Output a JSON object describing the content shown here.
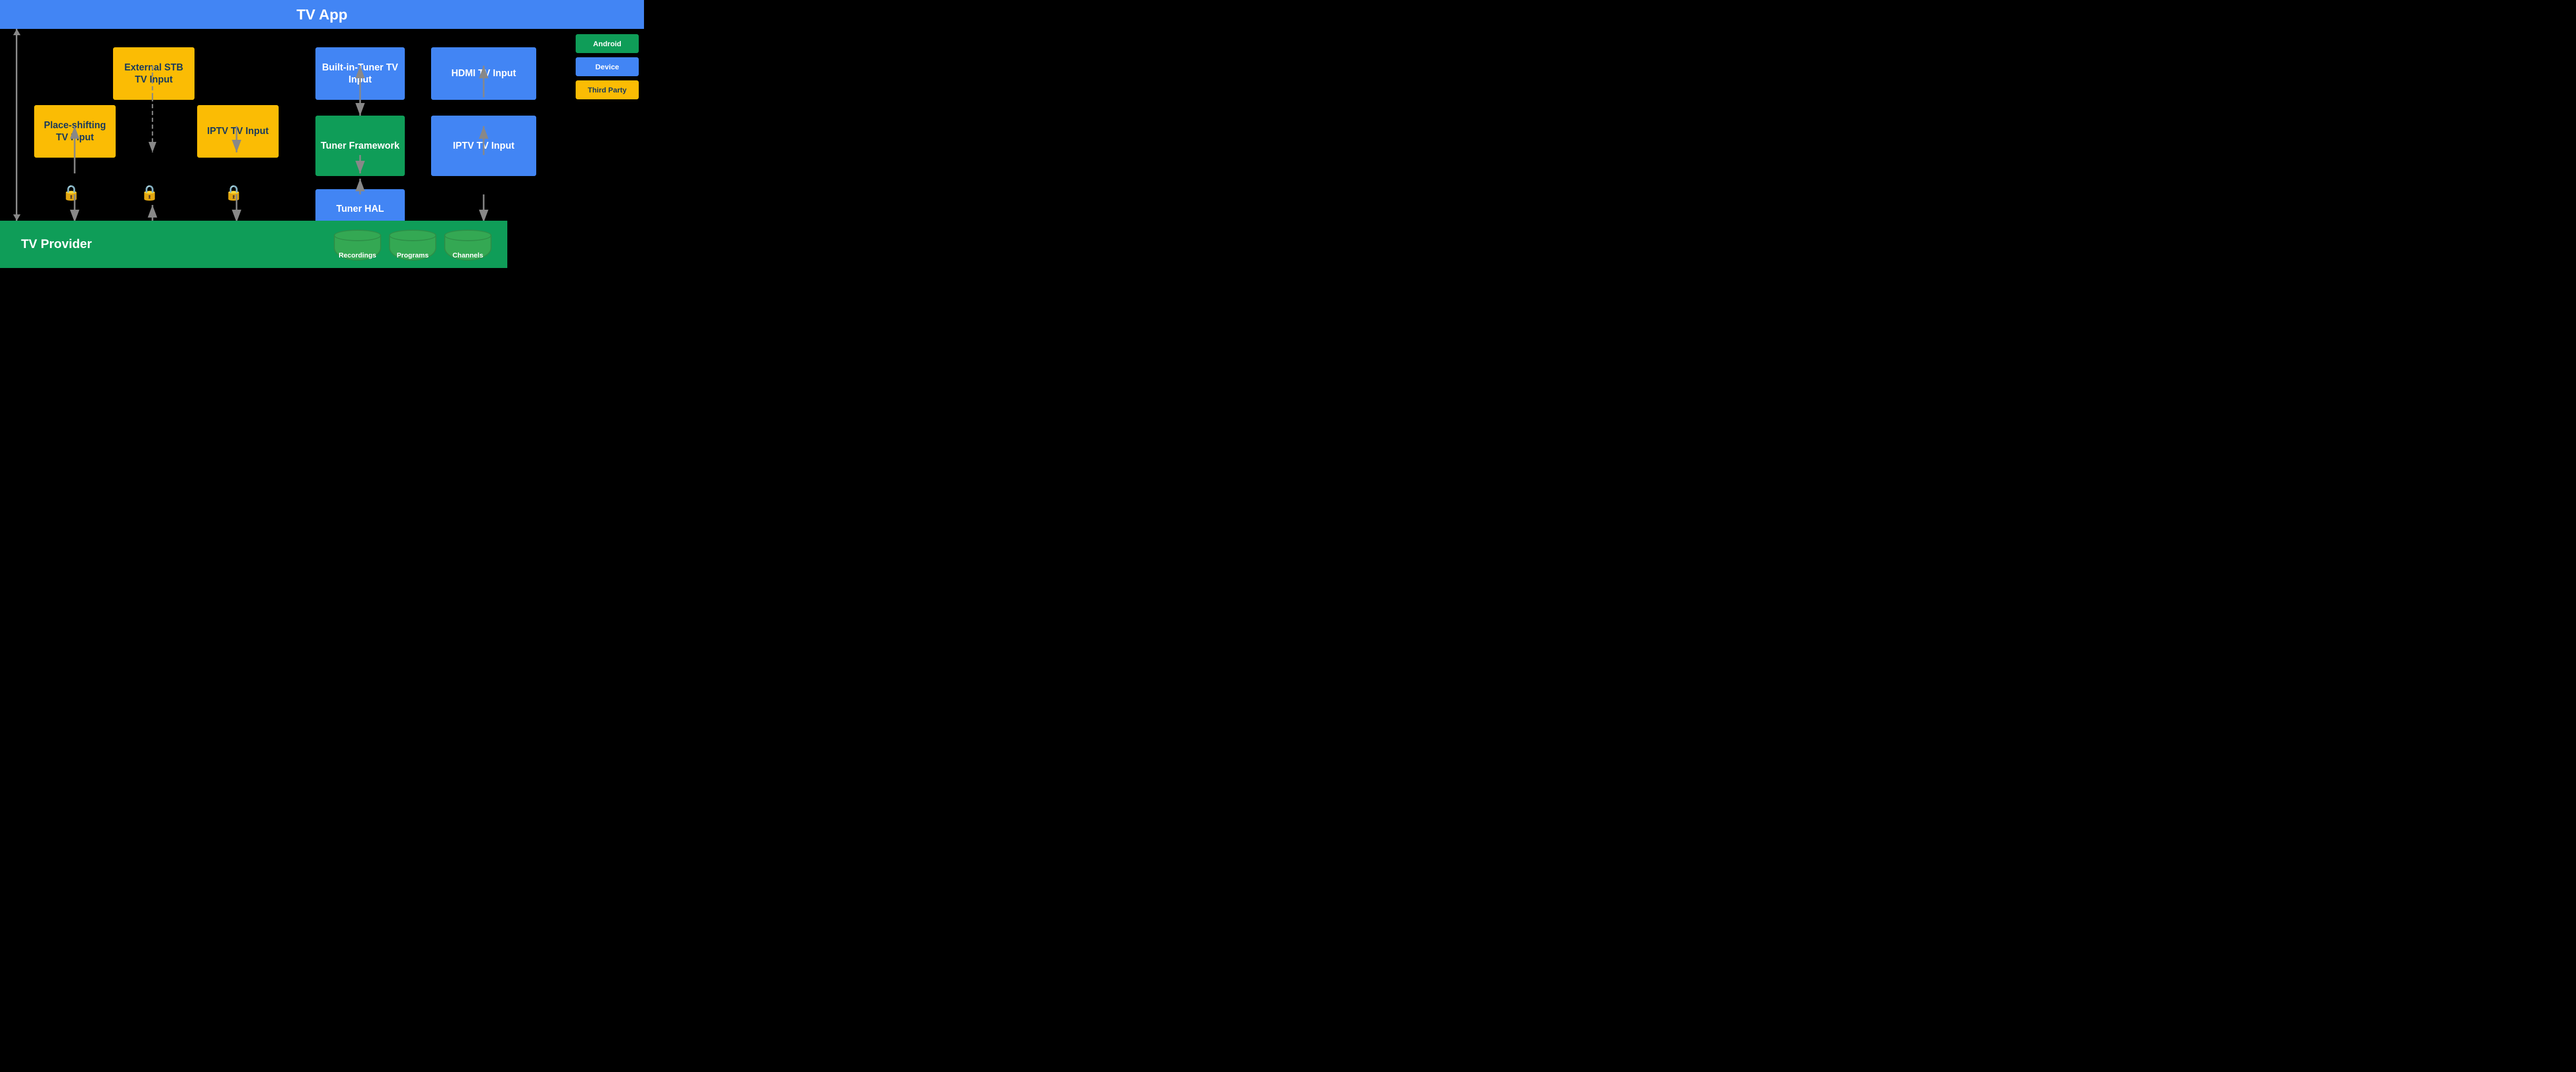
{
  "header": {
    "title": "TV App"
  },
  "footer": {
    "title": "TV Provider"
  },
  "legend": {
    "items": [
      {
        "label": "Android",
        "color": "#0F9D58"
      },
      {
        "label": "Device",
        "color": "#4285F4"
      },
      {
        "label": "Third Party",
        "color": "#FBBC04"
      }
    ]
  },
  "boxes": {
    "external_stb": "External STB\nTV Input",
    "place_shifting": "Place-shifting\nTV Input",
    "iptv_left": "IPTV\nTV Input",
    "built_in_tuner": "Built-in-Tuner\nTV Input",
    "tuner_framework": "Tuner\nFramework",
    "tuner_hal": "Tuner HAL",
    "hdmi_tv_input": "HDMI TV Input",
    "iptv_right": "IPTV\nTV Input"
  },
  "databases": [
    {
      "label": "Recordings"
    },
    {
      "label": "Programs"
    },
    {
      "label": "Channels"
    }
  ]
}
